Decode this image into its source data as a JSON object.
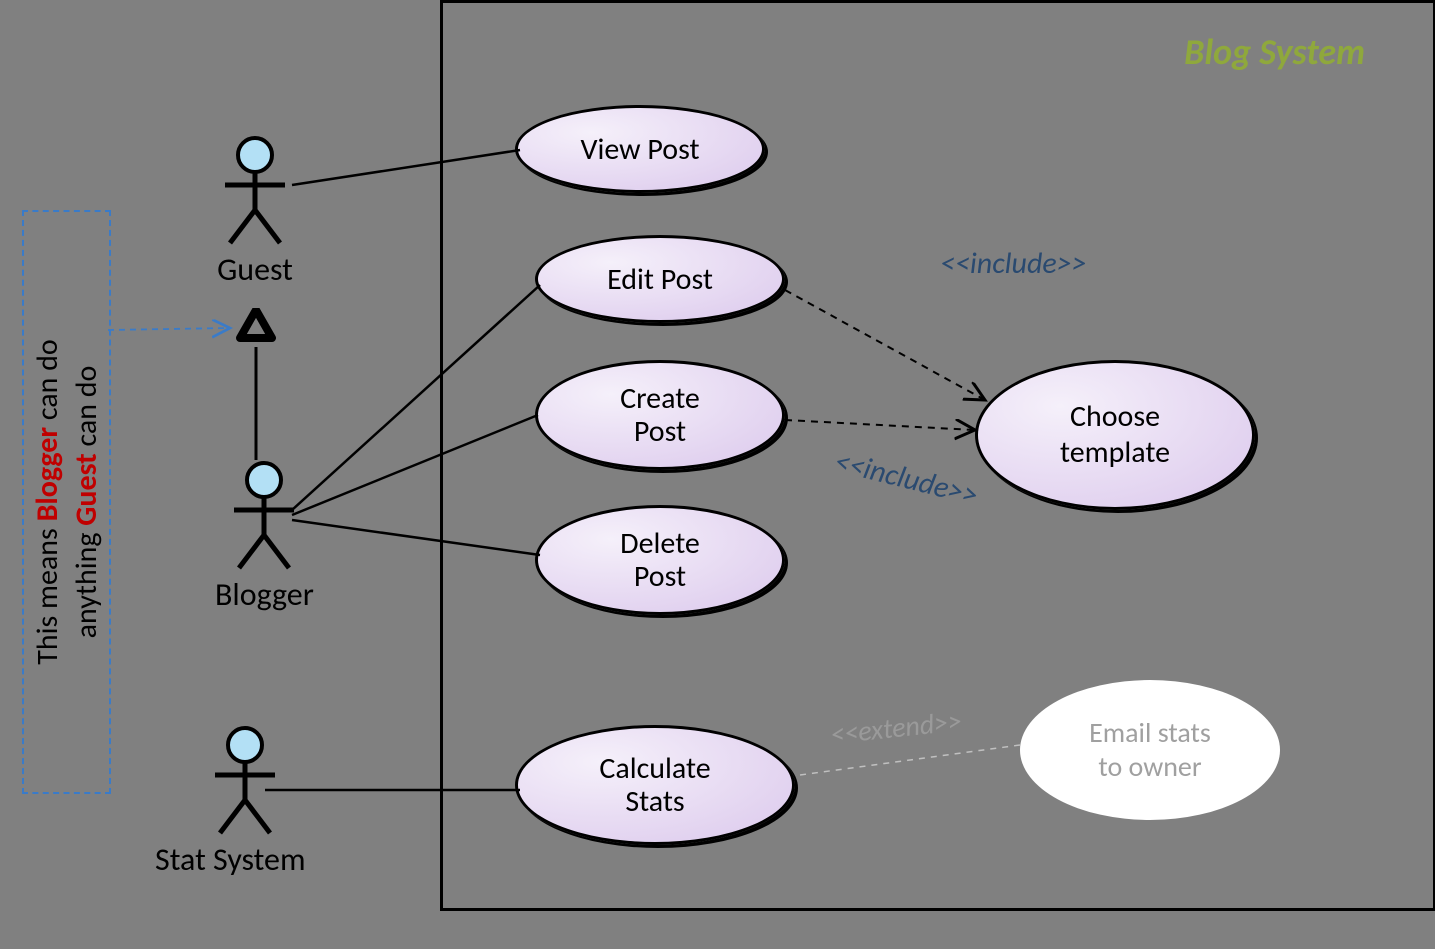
{
  "system": {
    "title": "Blog System"
  },
  "actors": {
    "guest": "Guest",
    "blogger": "Blogger",
    "stat": "Stat System"
  },
  "usecases": {
    "view": "View Post",
    "edit": "Edit Post",
    "create": "Create Post",
    "delete": "Delete Post",
    "choose": "Choose template",
    "calc": "Calculate Stats",
    "email": "Email stats to owner"
  },
  "stereotypes": {
    "include1": "<<include>>",
    "include2": "<<include>>",
    "extend": "<<extend>>"
  },
  "note": {
    "line1_pre": "This means ",
    "line1_red": "Blogger",
    "line1_post": " can do",
    "line2_pre": "anything ",
    "line2_red": "Guest",
    "line2_post": " can do"
  }
}
